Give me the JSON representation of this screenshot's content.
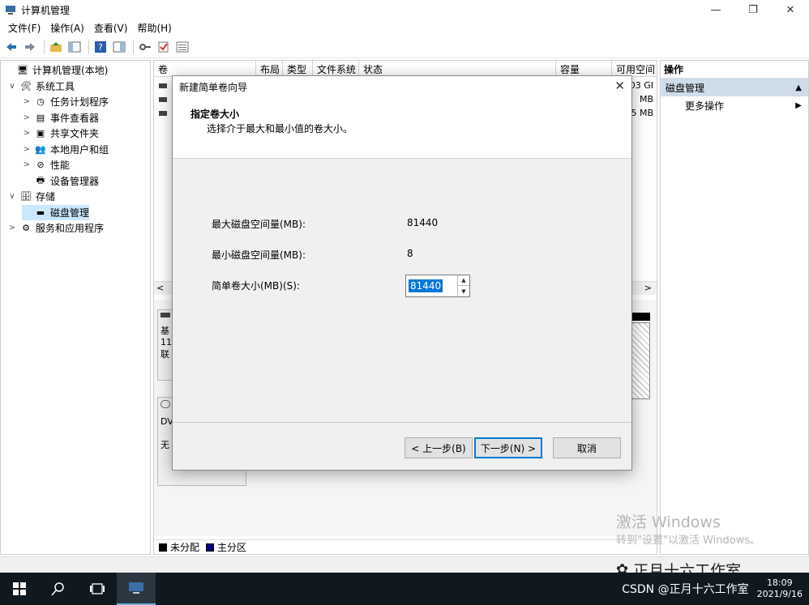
{
  "window": {
    "title": "计算机管理",
    "minimize": "—",
    "restore": "❐",
    "close": "✕"
  },
  "menu": [
    "文件(F)",
    "操作(A)",
    "查看(V)",
    "帮助(H)"
  ],
  "tree": [
    {
      "label": "计算机管理(本地)",
      "level": 0,
      "expander": "",
      "icon": "computer-mgmt-icon",
      "glyph": "🖥"
    },
    {
      "label": "系统工具",
      "level": 1,
      "expander": "∨",
      "icon": "tools-icon",
      "glyph": "🛠"
    },
    {
      "label": "任务计划程序",
      "level": 2,
      "expander": ">",
      "icon": "clock-icon",
      "glyph": "◷"
    },
    {
      "label": "事件查看器",
      "level": 2,
      "expander": ">",
      "icon": "event-icon",
      "glyph": "▤"
    },
    {
      "label": "共享文件夹",
      "level": 2,
      "expander": ">",
      "icon": "folder-icon",
      "glyph": "▣"
    },
    {
      "label": "本地用户和组",
      "level": 2,
      "expander": ">",
      "icon": "users-icon",
      "glyph": "👥"
    },
    {
      "label": "性能",
      "level": 2,
      "expander": ">",
      "icon": "no-icon",
      "glyph": "⊘"
    },
    {
      "label": "设备管理器",
      "level": 2,
      "expander": "",
      "icon": "device-icon",
      "glyph": "🖶"
    },
    {
      "label": "存储",
      "level": 1,
      "expander": "∨",
      "icon": "storage-icon",
      "glyph": "🗄"
    },
    {
      "label": "磁盘管理",
      "level": 2,
      "expander": "",
      "icon": "disk-icon",
      "glyph": "▬",
      "selected": true
    },
    {
      "label": "服务和应用程序",
      "level": 1,
      "expander": ">",
      "icon": "services-icon",
      "glyph": "⚙"
    }
  ],
  "columns": [
    "卷",
    "布局",
    "类型",
    "文件系统",
    "状态",
    "容量",
    "可用空间"
  ],
  "volumes": [
    {
      "cap": "03 GI"
    },
    {
      "cap": "MB"
    },
    {
      "cap": "5 MB"
    }
  ],
  "lower": {
    "disk0_text": [
      "基",
      "11",
      "联"
    ],
    "cd_text": [
      "DV",
      "无"
    ]
  },
  "legend": [
    {
      "label": "未分配",
      "color": "#000000"
    },
    {
      "label": "主分区",
      "color": "#00007f"
    }
  ],
  "actions": {
    "header": "操作",
    "selected": "磁盘管理",
    "items": [
      "更多操作"
    ]
  },
  "dialog": {
    "title": "新建简单卷向导",
    "heading": "指定卷大小",
    "subheading": "选择介于最大和最小值的卷大小。",
    "max_label": "最大磁盘空间量(MB):",
    "max_value": "81440",
    "min_label": "最小磁盘空间量(MB):",
    "min_value": "8",
    "size_label": "简单卷大小(MB)(S):",
    "size_value": "81440",
    "back": "< 上一步(B)",
    "next": "下一步(N) >",
    "cancel": "取消"
  },
  "watermark": {
    "line1": "激活 Windows",
    "line2": "转到\"设置\"以激活 Windows。",
    "brand": "正月十六工作室",
    "csdn": "CSDN @正月十六工作室"
  },
  "clock": {
    "time": "18:09",
    "date": "2021/9/16"
  }
}
